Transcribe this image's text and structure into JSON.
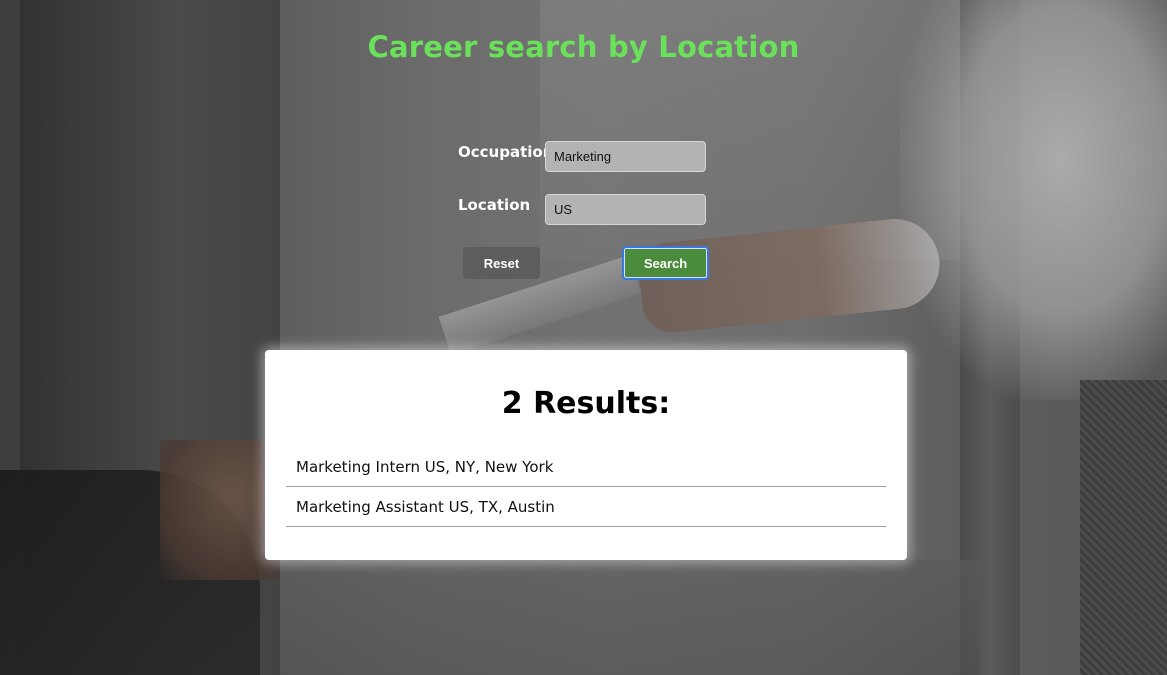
{
  "page": {
    "title": "Career search by Location",
    "title_color": "#6be05a"
  },
  "form": {
    "occupation": {
      "label": "Occupation",
      "value": "Marketing"
    },
    "location": {
      "label": "Location",
      "value": "US"
    },
    "reset_label": "Reset",
    "search_label": "Search",
    "search_color": "#4a8c3c"
  },
  "results": {
    "heading": "2 Results:",
    "items": [
      {
        "label": "Marketing Intern US, NY, New York"
      },
      {
        "label": "Marketing Assistant US, TX, Austin"
      }
    ]
  }
}
